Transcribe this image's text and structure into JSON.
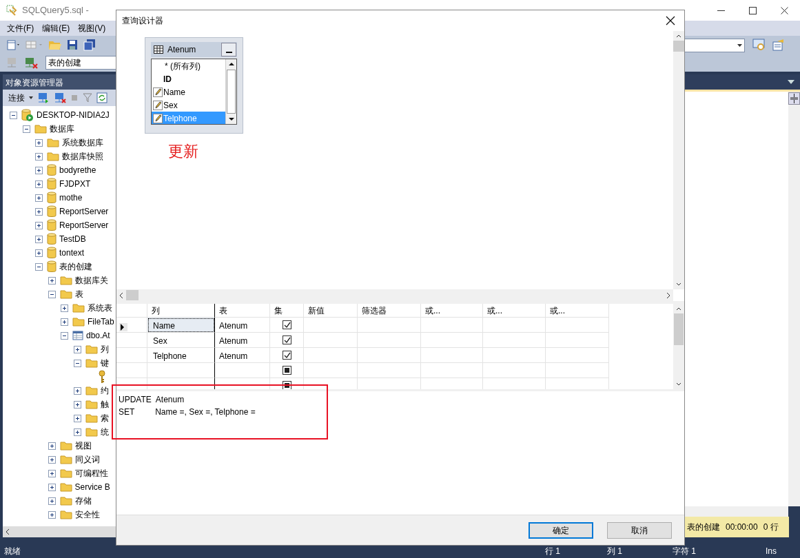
{
  "window": {
    "title": "SQLQuery5.sql -"
  },
  "menu": [
    "文件(F)",
    "编辑(E)",
    "视图(V)"
  ],
  "database_selector": {
    "value": "表的创建"
  },
  "object_explorer": {
    "title": "对象资源管理器",
    "connect": "连接",
    "tree": [
      {
        "label": "DESKTOP-NIDIA2J",
        "kind": "server",
        "expanded": true,
        "children": [
          {
            "label": "数据库",
            "kind": "folder",
            "expanded": true,
            "children": [
              {
                "label": "系统数据库",
                "kind": "folder",
                "expanded": false
              },
              {
                "label": "数据库快照",
                "kind": "folder",
                "expanded": false
              },
              {
                "label": "bodyrethe",
                "kind": "database",
                "expanded": false
              },
              {
                "label": "FJDPXT",
                "kind": "database",
                "expanded": false
              },
              {
                "label": "mothe",
                "kind": "database",
                "expanded": false
              },
              {
                "label": "ReportServer",
                "kind": "database",
                "expanded": false
              },
              {
                "label": "ReportServer",
                "kind": "database",
                "expanded": false
              },
              {
                "label": "TestDB",
                "kind": "database",
                "expanded": false
              },
              {
                "label": "tontext",
                "kind": "database",
                "expanded": false
              },
              {
                "label": "表的创建",
                "kind": "database",
                "expanded": true,
                "children": [
                  {
                    "label": "数据库关",
                    "kind": "folder",
                    "expanded": false
                  },
                  {
                    "label": "表",
                    "kind": "folder",
                    "expanded": true,
                    "children": [
                      {
                        "label": "系统表",
                        "kind": "folder",
                        "expanded": false
                      },
                      {
                        "label": "FileTab",
                        "kind": "folder",
                        "expanded": false
                      },
                      {
                        "label": "dbo.At",
                        "kind": "table",
                        "expanded": true,
                        "children": [
                          {
                            "label": "列",
                            "kind": "folder",
                            "expanded": false
                          },
                          {
                            "label": "键",
                            "kind": "folder",
                            "expanded": true,
                            "children": [
                              {
                                "kind": "key"
                              }
                            ]
                          },
                          {
                            "label": "约",
                            "kind": "folder",
                            "expanded": false
                          },
                          {
                            "label": "触",
                            "kind": "folder",
                            "expanded": false
                          },
                          {
                            "label": "索",
                            "kind": "folder",
                            "expanded": false
                          },
                          {
                            "label": "统",
                            "kind": "folder",
                            "expanded": false
                          }
                        ]
                      }
                    ]
                  },
                  {
                    "label": "视图",
                    "kind": "folder",
                    "expanded": false
                  },
                  {
                    "label": "同义词",
                    "kind": "folder",
                    "expanded": false
                  },
                  {
                    "label": "可编程性",
                    "kind": "folder",
                    "expanded": false
                  },
                  {
                    "label": "Service B",
                    "kind": "folder",
                    "expanded": false
                  },
                  {
                    "label": "存储",
                    "kind": "folder",
                    "expanded": false
                  },
                  {
                    "label": "安全性",
                    "kind": "folder",
                    "expanded": false
                  }
                ]
              }
            ]
          }
        ]
      }
    ]
  },
  "results_strip": {
    "database": "表的创建",
    "elapsed": "00:00:00",
    "rows": "0 行"
  },
  "status_bar": {
    "message": "就绪",
    "line": "行 1",
    "column": "列 1",
    "char": "字符 1",
    "mode": "Ins"
  },
  "dialog": {
    "title": "查询设计器",
    "table_widget": {
      "name": "Atenum",
      "columns": [
        {
          "label": "* (所有列)",
          "kind": "all",
          "updated": false,
          "selected": false
        },
        {
          "label": "ID",
          "kind": "key",
          "updated": false,
          "selected": false
        },
        {
          "label": "Name",
          "kind": "field",
          "updated": true,
          "selected": false
        },
        {
          "label": "Sex",
          "kind": "field",
          "updated": true,
          "selected": false
        },
        {
          "label": "Telphone",
          "kind": "field",
          "updated": true,
          "selected": true
        }
      ]
    },
    "annotation": "更新",
    "grid": {
      "columns": [
        "列",
        "表",
        "集",
        "新值",
        "筛选器",
        "或...",
        "或...",
        "或..."
      ],
      "rows": [
        {
          "kind": "data",
          "column": "Name",
          "table": "Atenum",
          "set": true,
          "current": true
        },
        {
          "kind": "data",
          "column": "Sex",
          "table": "Atenum",
          "set": true,
          "current": false
        },
        {
          "kind": "data",
          "column": "Telphone",
          "table": "Atenum",
          "set": true,
          "current": false
        },
        {
          "kind": "empty",
          "set": true,
          "current": false
        },
        {
          "kind": "empty",
          "set": true,
          "current": false
        }
      ]
    },
    "sql": [
      "UPDATE  Atenum",
      "SET         Name =, Sex =, Telphone ="
    ],
    "buttons": [
      {
        "label": "确定",
        "default": true
      },
      {
        "label": "取消",
        "default": false
      }
    ]
  }
}
